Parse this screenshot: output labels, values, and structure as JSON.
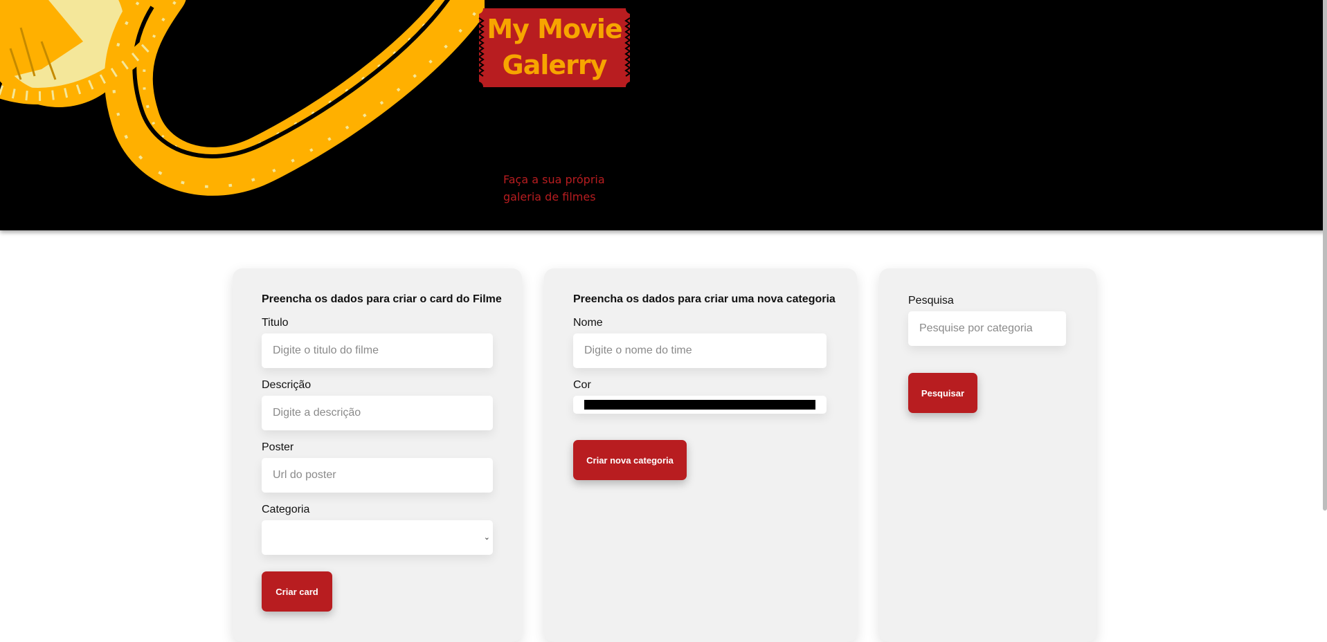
{
  "colors": {
    "header_bg": "#000000",
    "film": "#ffb000",
    "ticket": "#b81d20",
    "title_text": "#f7a500",
    "button": "#b81d20",
    "panel_bg": "#f1f1f1"
  },
  "header": {
    "title_line1": "My Movie",
    "title_line2": "Galerry",
    "tagline": "Faça a sua própria galeria de filmes"
  },
  "movie_form": {
    "title": "Preencha os dados para criar o card do Filme",
    "titulo_label": "Titulo",
    "titulo_placeholder": "Digite o titulo do filme",
    "descricao_label": "Descrição",
    "descricao_placeholder": "Digite a descrição",
    "poster_label": "Poster",
    "poster_placeholder": "Url do poster",
    "categoria_label": "Categoria",
    "categoria_value": "",
    "submit_label": "Criar card"
  },
  "category_form": {
    "title": "Preencha os dados para criar uma nova categoria",
    "nome_label": "Nome",
    "nome_placeholder": "Digite o nome do time",
    "cor_label": "Cor",
    "cor_value": "#000000",
    "submit_label": "Criar nova categoria"
  },
  "search_form": {
    "label": "Pesquisa",
    "placeholder": "Pesquise por categoria",
    "submit_label": "Pesquisar"
  },
  "icons": {
    "select_arrow": "chevron-down-icon"
  }
}
